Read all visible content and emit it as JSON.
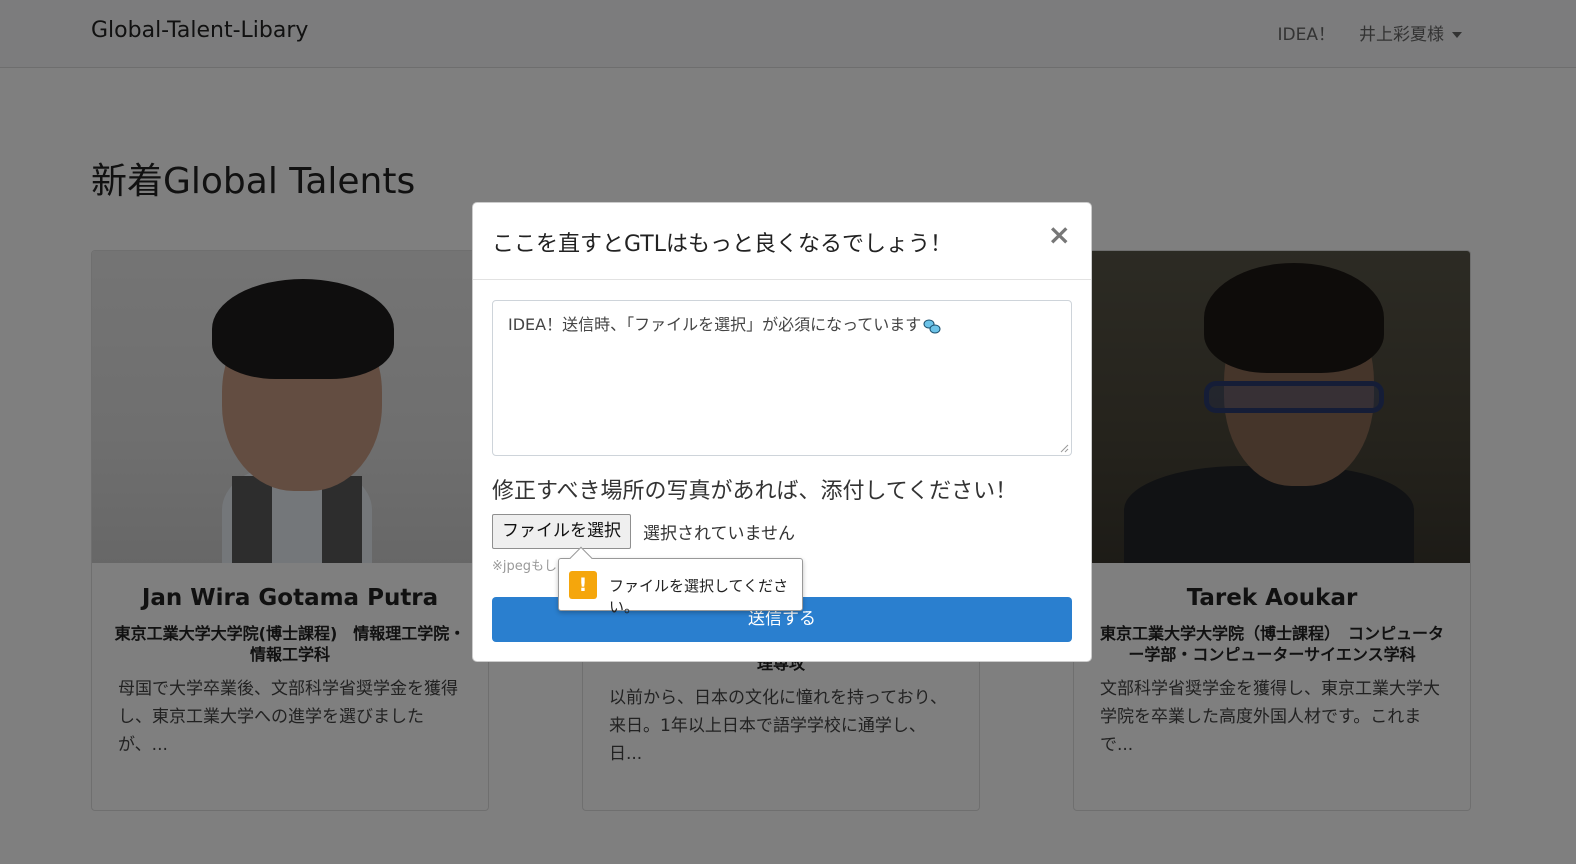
{
  "navbar": {
    "brand": "Global-Talent-Libary",
    "idea_link": "IDEA！",
    "user_menu": "井上彩夏様"
  },
  "page": {
    "title": "新着Global Talents"
  },
  "cards": [
    {
      "name": "Jan Wira Gotama Putra",
      "school": "東京工業大学大学院(博士課程)　情報理工学院・情報工学科",
      "description": "母国で大学卒業後、文部科学省奨学金を獲得し、東京工業大学への進学を選びましたが、..."
    },
    {
      "name": "",
      "school": "理専攻",
      "description": "以前から、日本の文化に憧れを持っており、来日。1年以上日本で語学学校に通学し、日..."
    },
    {
      "name": "Tarek Aoukar",
      "school": "東京工業大学大学院（博士課程）　コンピューター学部・コンピューターサイエンス学科",
      "description": "文部科学省奨学金を獲得し、東京工業大学大学院を卒業した高度外国人材です。これまで..."
    }
  ],
  "modal": {
    "title": "ここを直すとGTLはもっと良くなるでしょう！",
    "close_symbol": "×",
    "textarea_value": "IDEA！送信時、「ファイルを選択」が必須になっています",
    "upload_label": "修正すべき場所の写真があれば、添付してください！",
    "file_button": "ファイルを選択",
    "file_status": "選択されていません",
    "hint": "※jpegもし",
    "submit": "送信する"
  },
  "tooltip": {
    "icon": "!",
    "message": "ファイルを選択してください。"
  },
  "colors": {
    "primary": "#2a7fcf",
    "warning": "#f5a60c",
    "overlay": "rgba(0,0,0,0.5)"
  }
}
